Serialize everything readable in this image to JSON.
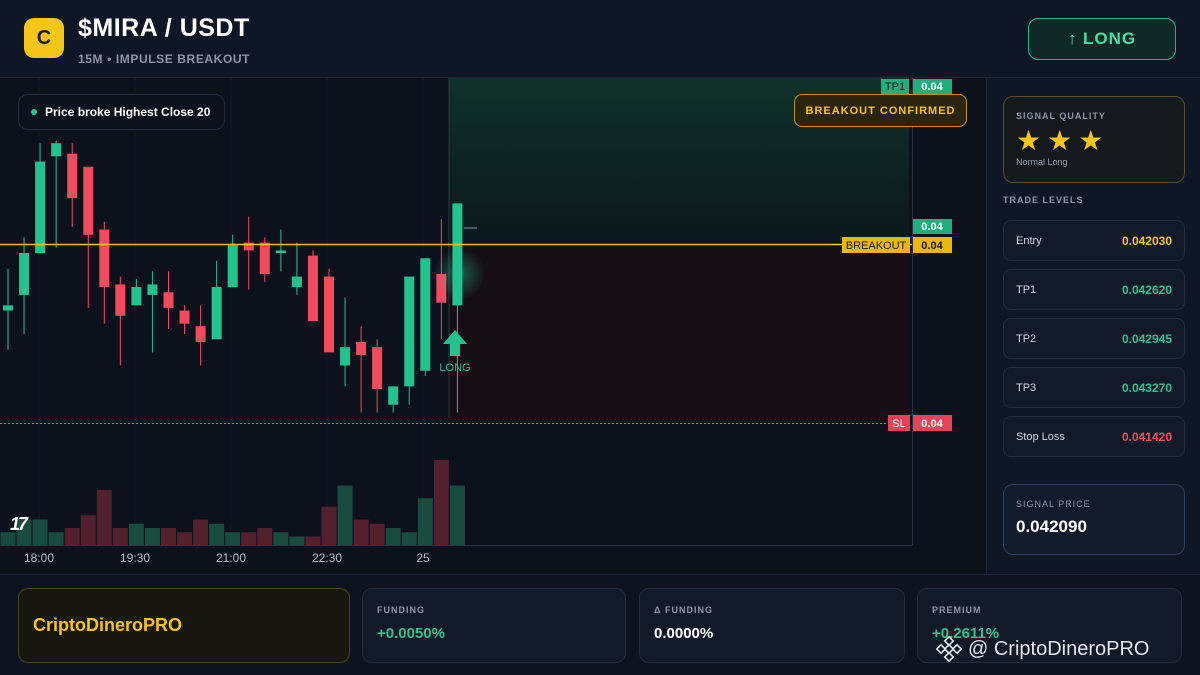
{
  "header": {
    "logo_letter": "C",
    "pair": "$MIRA / USDT",
    "subtitle": "15M • IMPULSE BREAKOUT",
    "long_button": "↑ LONG"
  },
  "chart": {
    "note": "Price broke Highest Close 20",
    "badge": "BREAKOUT CONFIRMED",
    "tv_logo": "17",
    "signal_label": "LONG",
    "tags": {
      "tp1_label": "TP1",
      "tp1_value": "0.04",
      "current_value": "0.04",
      "breakout_label": "BREAKOUT",
      "breakout_value": "0.04",
      "sl_label": "SL",
      "sl_value": "0.04"
    },
    "time_labels": [
      "18:00",
      "19:30",
      "21:00",
      "22:30",
      "25"
    ],
    "colors": {
      "up": "#22c38e",
      "down": "#f24b5f",
      "breakout": "#f5c518",
      "sl": "#f24b5f"
    }
  },
  "chart_data": {
    "type": "candlestick",
    "x": [
      "t1",
      "t2",
      "t3",
      "t4",
      "t5",
      "t6",
      "t7",
      "t8",
      "t9",
      "t10",
      "t11",
      "t12",
      "t13",
      "t14",
      "t15",
      "t16",
      "t17",
      "t18",
      "t19",
      "t20",
      "t21",
      "t22",
      "t23",
      "t24",
      "t25",
      "t26",
      "t27",
      "t28",
      "t29"
    ],
    "open": [
      0.04079,
      0.04085,
      0.04101,
      0.04138,
      0.04139,
      0.04134,
      0.0411,
      0.04089,
      0.04081,
      0.04085,
      0.04086,
      0.04079,
      0.04073,
      0.04068,
      0.04088,
      0.04105,
      0.04105,
      0.04101,
      0.04088,
      0.041,
      0.04092,
      0.04058,
      0.04067,
      0.04065,
      0.04043,
      0.0405,
      0.04056,
      0.04093,
      0.04081
    ],
    "high": [
      0.04095,
      0.04107,
      0.04143,
      0.04144,
      0.04143,
      0.04117,
      0.04113,
      0.04092,
      0.04091,
      0.04094,
      0.04094,
      0.04081,
      0.04081,
      0.04098,
      0.04108,
      0.04115,
      0.04107,
      0.0411,
      0.04105,
      0.04102,
      0.04095,
      0.04084,
      0.04073,
      0.04068,
      0.0405,
      0.04071,
      0.04097,
      0.04114,
      0.0412
    ],
    "low": [
      0.04064,
      0.0407,
      0.04101,
      0.04103,
      0.04111,
      0.0408,
      0.04074,
      0.04058,
      0.04088,
      0.04063,
      0.04072,
      0.0407,
      0.04058,
      0.0407,
      0.04099,
      0.04087,
      0.0409,
      0.04094,
      0.04085,
      0.04086,
      0.04065,
      0.0405,
      0.0404,
      0.0404,
      0.0404,
      0.04043,
      0.04054,
      0.04068,
      0.0404
    ],
    "close": [
      0.04081,
      0.04101,
      0.04136,
      0.04143,
      0.04122,
      0.04108,
      0.04088,
      0.04077,
      0.04088,
      0.04089,
      0.0408,
      0.04074,
      0.04067,
      0.04088,
      0.04104,
      0.04102,
      0.04093,
      0.04102,
      0.04092,
      0.04075,
      0.04063,
      0.04065,
      0.04062,
      0.04049,
      0.0405,
      0.04092,
      0.04099,
      0.04082,
      0.0412
    ],
    "volume": [
      3,
      6,
      6,
      3,
      4,
      7,
      13,
      4,
      5,
      4,
      4,
      3,
      6,
      5,
      3,
      3,
      4,
      3,
      2,
      2,
      9,
      14,
      6,
      5,
      4,
      3,
      11,
      20,
      14
    ],
    "levels": {
      "tp1": 0.04262,
      "breakout": 0.04115,
      "current": 0.04209,
      "stop_loss": 0.04142
    },
    "ylim": [
      0.04036,
      0.04145
    ],
    "xlabel": "",
    "ylabel": ""
  },
  "sidebar": {
    "quality_title": "SIGNAL QUALITY",
    "stars": "★★★",
    "quality_sub": "Normal Long",
    "levels_title": "TRADE LEVELS",
    "levels": [
      {
        "label": "Entry",
        "value": "0.042030",
        "color": "#f5c518"
      },
      {
        "label": "TP1",
        "value": "0.042620",
        "color": "#29c38f"
      },
      {
        "label": "TP2",
        "value": "0.042945",
        "color": "#29c38f"
      },
      {
        "label": "TP3",
        "value": "0.043270",
        "color": "#29c38f"
      },
      {
        "label": "Stop Loss",
        "value": "0.041420",
        "color": "#f24b5f"
      }
    ],
    "signal_price_title": "SIGNAL PRICE",
    "signal_price": "0.042090"
  },
  "footer": {
    "brand": "CriptoDineroPRO",
    "metrics": [
      {
        "title": "FUNDING",
        "value": "+0.0050%",
        "color": "#29c38f"
      },
      {
        "title": "Δ FUNDING",
        "value": "0.0000%",
        "color": "#ffffff"
      },
      {
        "title": "PREMIUM",
        "value": "+0.2611%",
        "color": "#29c38f"
      }
    ],
    "watermark": "@ CriptoDineroPRO"
  }
}
